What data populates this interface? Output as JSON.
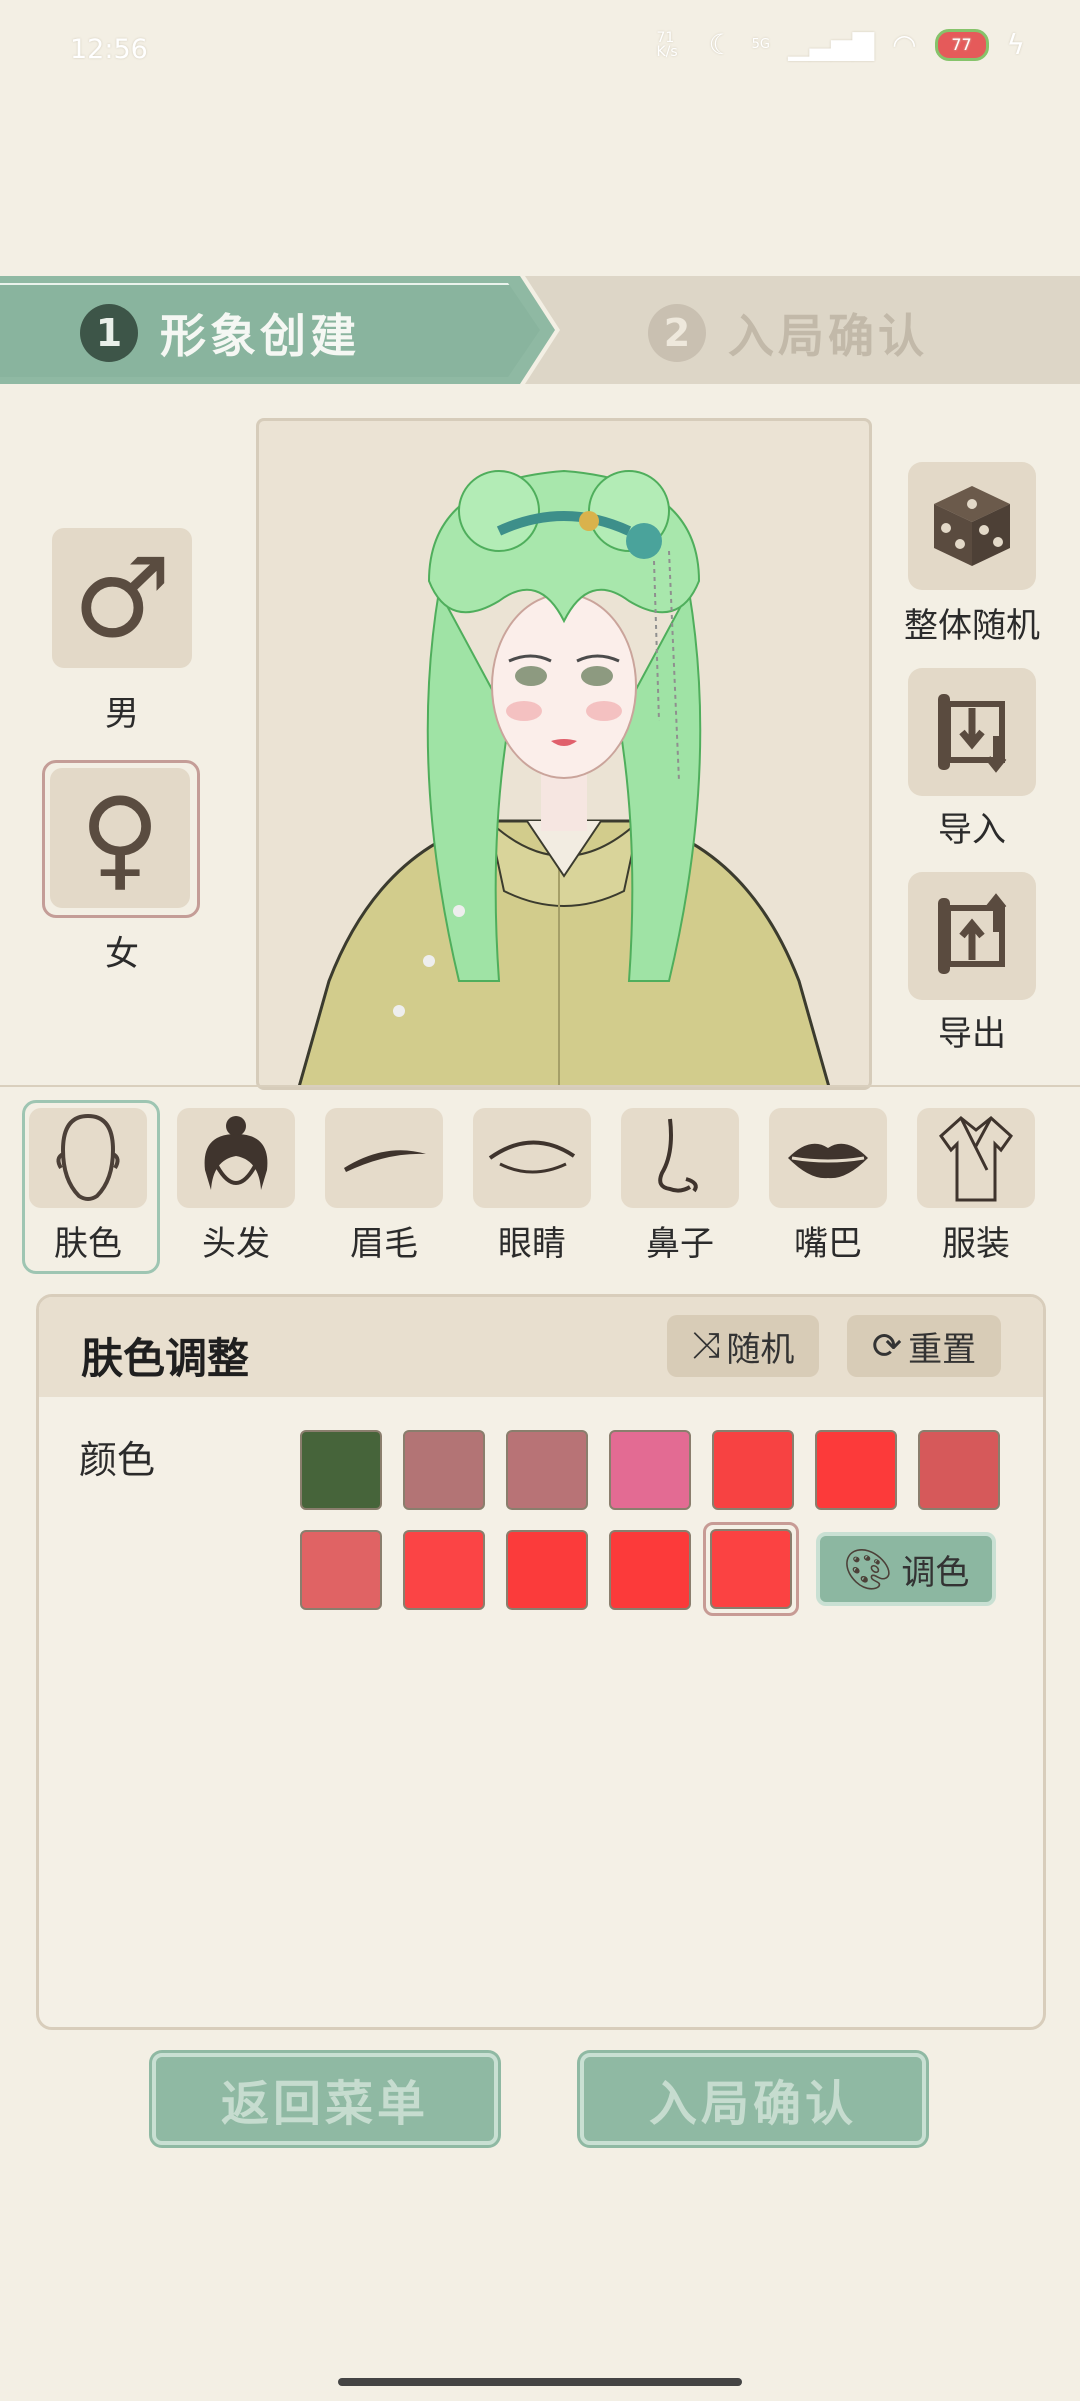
{
  "status_bar": {
    "time": "12:56",
    "speed": "71 K/s",
    "network": "5G",
    "battery": "77"
  },
  "steps": [
    {
      "num": "1",
      "label": "形象创建"
    },
    {
      "num": "2",
      "label": "入局确认"
    }
  ],
  "gender": {
    "male_label": "男",
    "female_label": "女",
    "male_symbol": "♂",
    "female_symbol": "♀",
    "selected": "female"
  },
  "actions": {
    "random_all": "整体随机",
    "import": "导入",
    "export": "导出"
  },
  "categories": [
    "肤色",
    "头发",
    "眉毛",
    "眼睛",
    "鼻子",
    "嘴巴",
    "服装"
  ],
  "panel": {
    "title": "肤色调整",
    "random_label": "随机",
    "reset_label": "重置",
    "color_label": "颜色",
    "palette_label": "调色",
    "swatches": [
      "#46643a",
      "#b37475",
      "#b87376",
      "#e36b93",
      "#f74242",
      "#fc3a3a",
      "#d6595a",
      "#e06364",
      "#fb4445",
      "#fb3b3b",
      "#fc3a3a",
      "#fb4242"
    ],
    "selected_index": 11
  },
  "footer": {
    "back_label": "返回菜单",
    "confirm_label": "入局确认"
  },
  "colors": {
    "accent": "#8fb9a3",
    "background": "#f3efe4"
  }
}
